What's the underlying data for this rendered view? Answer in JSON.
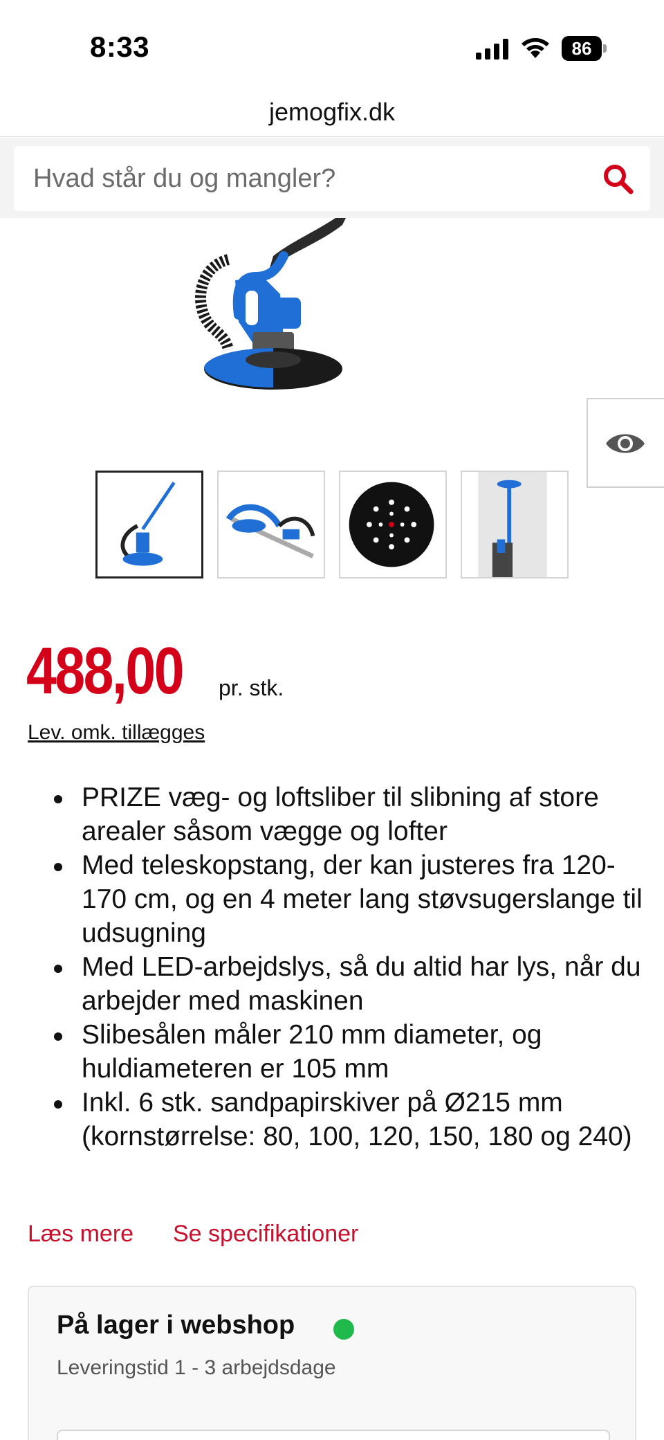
{
  "status_bar": {
    "time": "8:33",
    "battery": "86",
    "battery_level": 0.86
  },
  "browser": {
    "url": "jemogfix.dk"
  },
  "search": {
    "placeholder": "Hvad står du og mangler?"
  },
  "product": {
    "price": "488,00",
    "price_unit": "pr. stk.",
    "shipping_note": "Lev. omk. tillægges",
    "features": [
      "PRIZE væg- og loftsliber til slibning af store arealer såsom vægge og lofter",
      "Med teleskopstang, der kan justeres fra 120-170 cm, og en 4 meter lang støvsugerslange til udsugning",
      "Med LED-arbejdslys, så du altid har lys, når du arbejder med maskinen",
      "Slibesålen måler 210 mm diameter, og huldiameteren er 105 mm",
      "Inkl. 6 stk. sandpapirskiver på Ø215 mm (kornstørrelse: 80, 100, 120, 150, 180 og 240)"
    ],
    "read_more": "Læs mere",
    "see_specs": "Se specifikationer"
  },
  "stock": {
    "title": "På lager i webshop",
    "delivery": "Leveringstid 1 - 3 arbejdsdage"
  },
  "colors": {
    "accent": "#d4001a",
    "link": "#c8102e",
    "in_stock": "#1fba4b",
    "product_blue": "#1f6fd6"
  },
  "icons": [
    "signal-icon",
    "wifi-icon",
    "battery-icon",
    "search-icon",
    "eye-icon"
  ]
}
